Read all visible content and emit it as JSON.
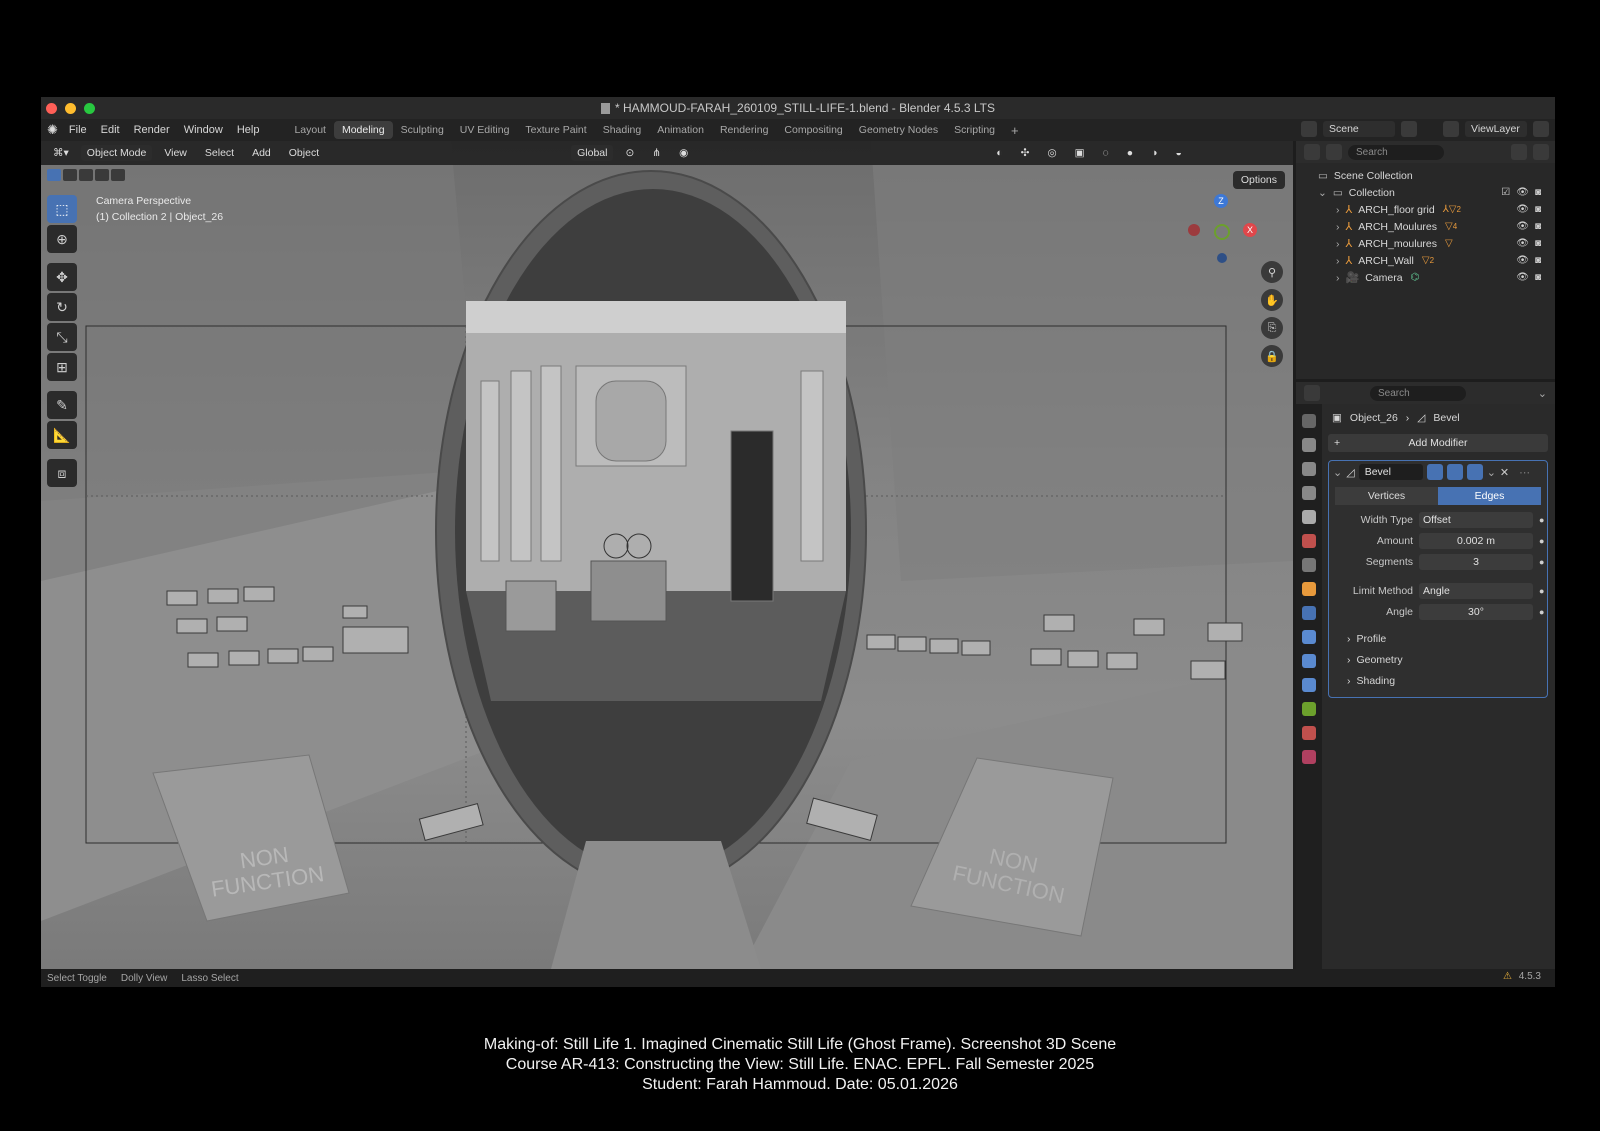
{
  "window": {
    "title": "* HAMMOUD-FARAH_260109_STILL-LIFE-1.blend - Blender 4.5.3 LTS",
    "traffic_colors": [
      "#ff5f57",
      "#febc2e",
      "#28c840"
    ]
  },
  "menubar": {
    "items": [
      "File",
      "Edit",
      "Render",
      "Window",
      "Help"
    ],
    "workspaces": [
      "Layout",
      "Modeling",
      "Sculpting",
      "UV Editing",
      "Texture Paint",
      "Shading",
      "Animation",
      "Rendering",
      "Compositing",
      "Geometry Nodes",
      "Scripting"
    ],
    "active_workspace": "Modeling",
    "add_tab": "+",
    "scene": "Scene",
    "view_layer": "ViewLayer"
  },
  "viewport": {
    "mode": "Object Mode",
    "menus": [
      "View",
      "Select",
      "Add",
      "Object"
    ],
    "orientation": "Global",
    "options": "Options",
    "info_line1": "Camera Perspective",
    "info_line2": "(1) Collection 2 | Object_26",
    "gizmo_labels": [
      "Z",
      "X"
    ],
    "scene_texts": [
      "NON FUNCTION",
      "NON FUNCTION"
    ]
  },
  "outliner": {
    "search_placeholder": "Search",
    "scene_collection": "Scene Collection",
    "collection": "Collection",
    "items": [
      {
        "name": "ARCH_floor grid",
        "extra": "2"
      },
      {
        "name": "ARCH_Moulures",
        "extra": "4"
      },
      {
        "name": "ARCH_moulures",
        "extra": ""
      },
      {
        "name": "ARCH_Wall",
        "extra": "2"
      },
      {
        "name": "Camera",
        "extra": ""
      }
    ]
  },
  "properties": {
    "search_placeholder": "Search",
    "breadcrumb_object": "Object_26",
    "breadcrumb_modifier": "Bevel",
    "add_modifier": "Add Modifier",
    "modifier_name": "Bevel",
    "affect_options": [
      "Vertices",
      "Edges"
    ],
    "affect_active": "Edges",
    "width_type_label": "Width Type",
    "width_type": "Offset",
    "amount_label": "Amount",
    "amount": "0.002 m",
    "segments_label": "Segments",
    "segments": "3",
    "limit_method_label": "Limit Method",
    "limit_method": "Angle",
    "angle_label": "Angle",
    "angle": "30°",
    "subpanels": [
      "Profile",
      "Geometry",
      "Shading"
    ]
  },
  "statusbar": {
    "hints": [
      "Select Toggle",
      "Dolly View",
      "Lasso Select"
    ],
    "version": "4.5.3"
  },
  "caption": {
    "line1": "Making-of: Still Life 1. Imagined Cinematic Still Life (Ghost Frame). Screenshot 3D Scene",
    "line2": "Course AR-413: Constructing the View: Still Life. ENAC. EPFL. Fall Semester 2025",
    "line3": "Student: Farah Hammoud. Date: 05.01.2026"
  },
  "colors": {
    "accent": "#4772b3",
    "object_orange": "#e89a3c",
    "gizmo_x": "#e0474b",
    "gizmo_y": "#6ca02c",
    "gizmo_z": "#3d78d6"
  }
}
